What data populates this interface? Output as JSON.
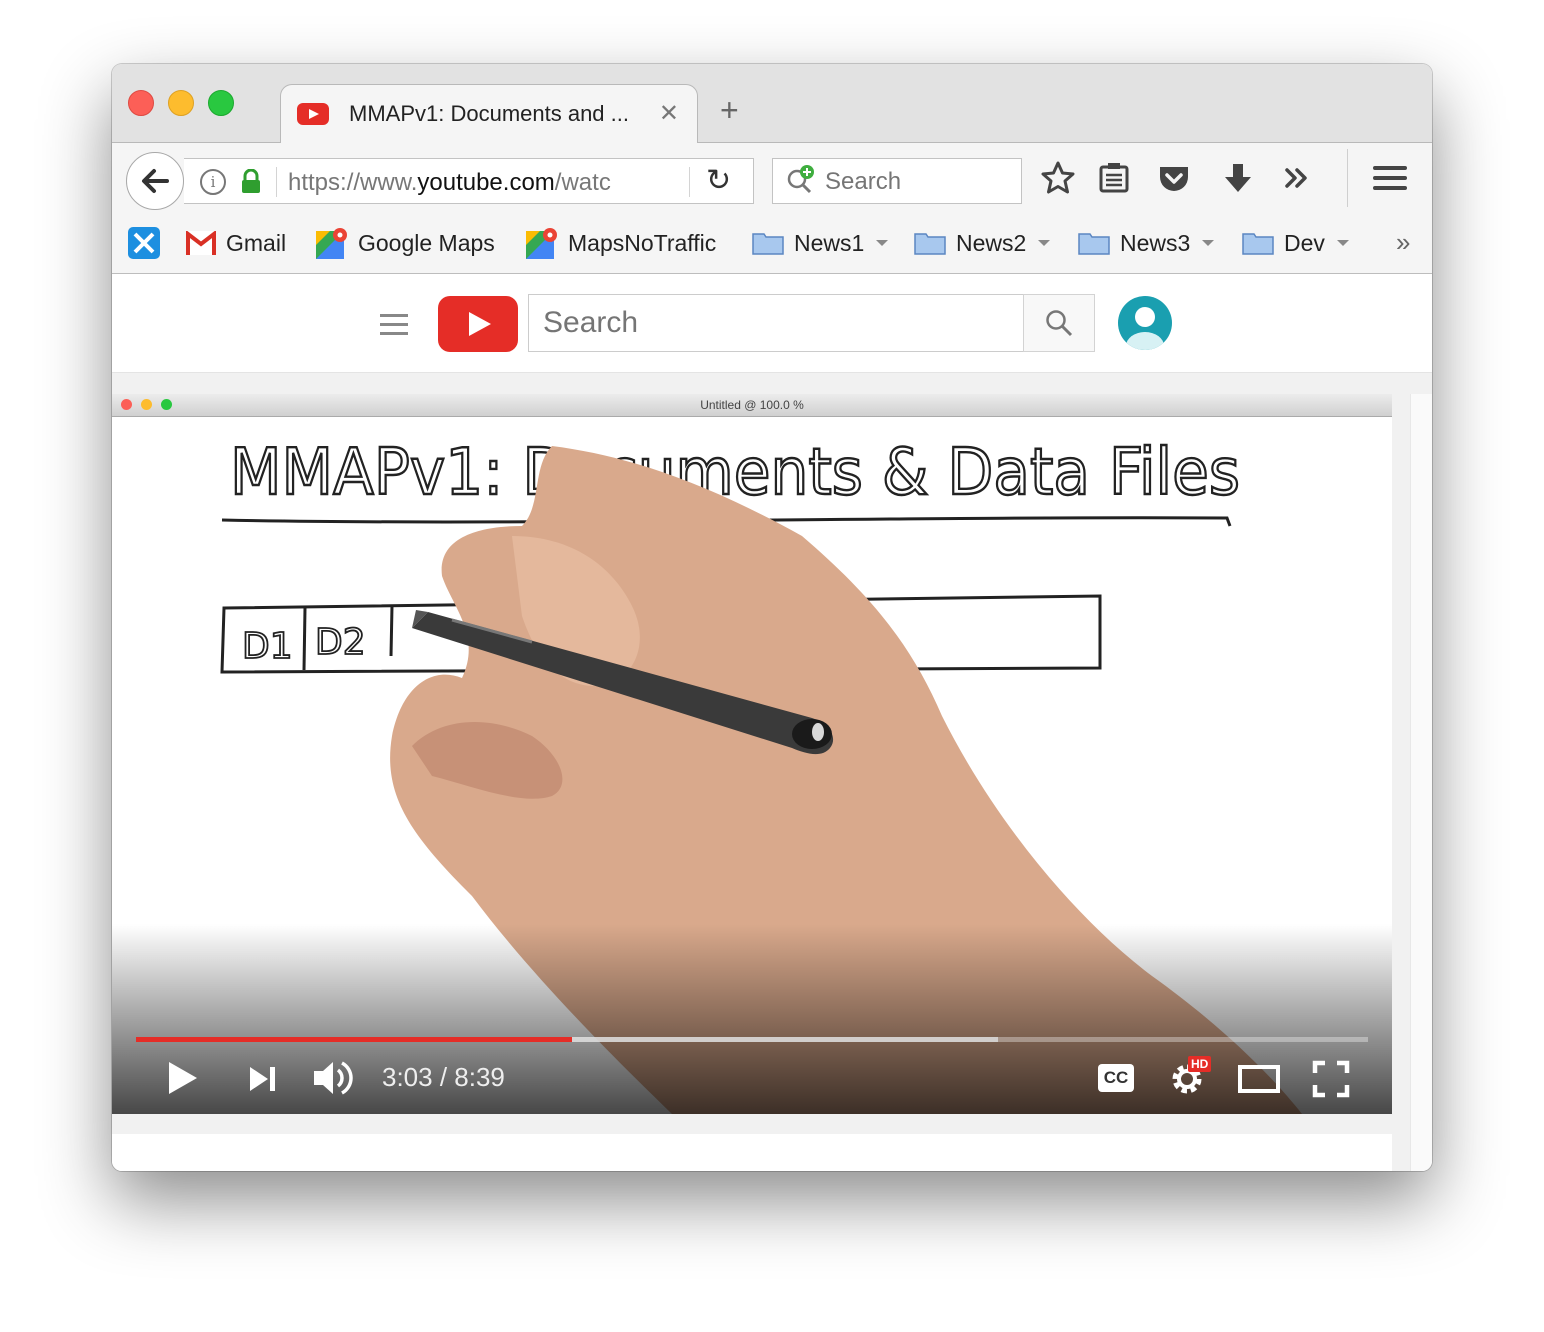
{
  "browser": {
    "tab": {
      "title": "MMAPv1: Documents and ...",
      "close_glyph": "✕",
      "favicon": "youtube-icon"
    },
    "new_tab_glyph": "+",
    "url": {
      "prefix": "https://www.",
      "domain": "youtube.com",
      "suffix": "/watc"
    },
    "search": {
      "placeholder": "Search"
    },
    "toolbar_icons": [
      "star-icon",
      "reader-icon",
      "pocket-icon",
      "download-icon",
      "overflow-icon",
      "hamburger-icon"
    ],
    "overflow_glyph": "»"
  },
  "bookmarks": [
    {
      "label": "Gmail",
      "icon": "gmail-icon"
    },
    {
      "label": "Google Maps",
      "icon": "maps-icon"
    },
    {
      "label": "MapsNoTraffic",
      "icon": "maps-icon"
    },
    {
      "label": "News1",
      "icon": "folder-icon",
      "folder": true
    },
    {
      "label": "News2",
      "icon": "folder-icon",
      "folder": true
    },
    {
      "label": "News3",
      "icon": "folder-icon",
      "folder": true
    },
    {
      "label": "Dev",
      "icon": "folder-icon",
      "folder": true
    }
  ],
  "youtube": {
    "search_placeholder": "Search"
  },
  "video": {
    "inner_window_title": "Untitled @ 100.0 %",
    "whiteboard_title": "MMAPv1: Documents & Data Files",
    "cells": [
      "D1",
      "D2"
    ],
    "time_current": "3:03",
    "time_total": "8:39",
    "progress": {
      "played_fraction": 0.354,
      "buffered_fraction": 0.7
    },
    "hd_badge": "HD",
    "cc_label": "CC"
  },
  "colors": {
    "youtube_red": "#e52d27",
    "lock_green": "#2f9e2f",
    "avatar_teal": "#1a9fb0"
  }
}
